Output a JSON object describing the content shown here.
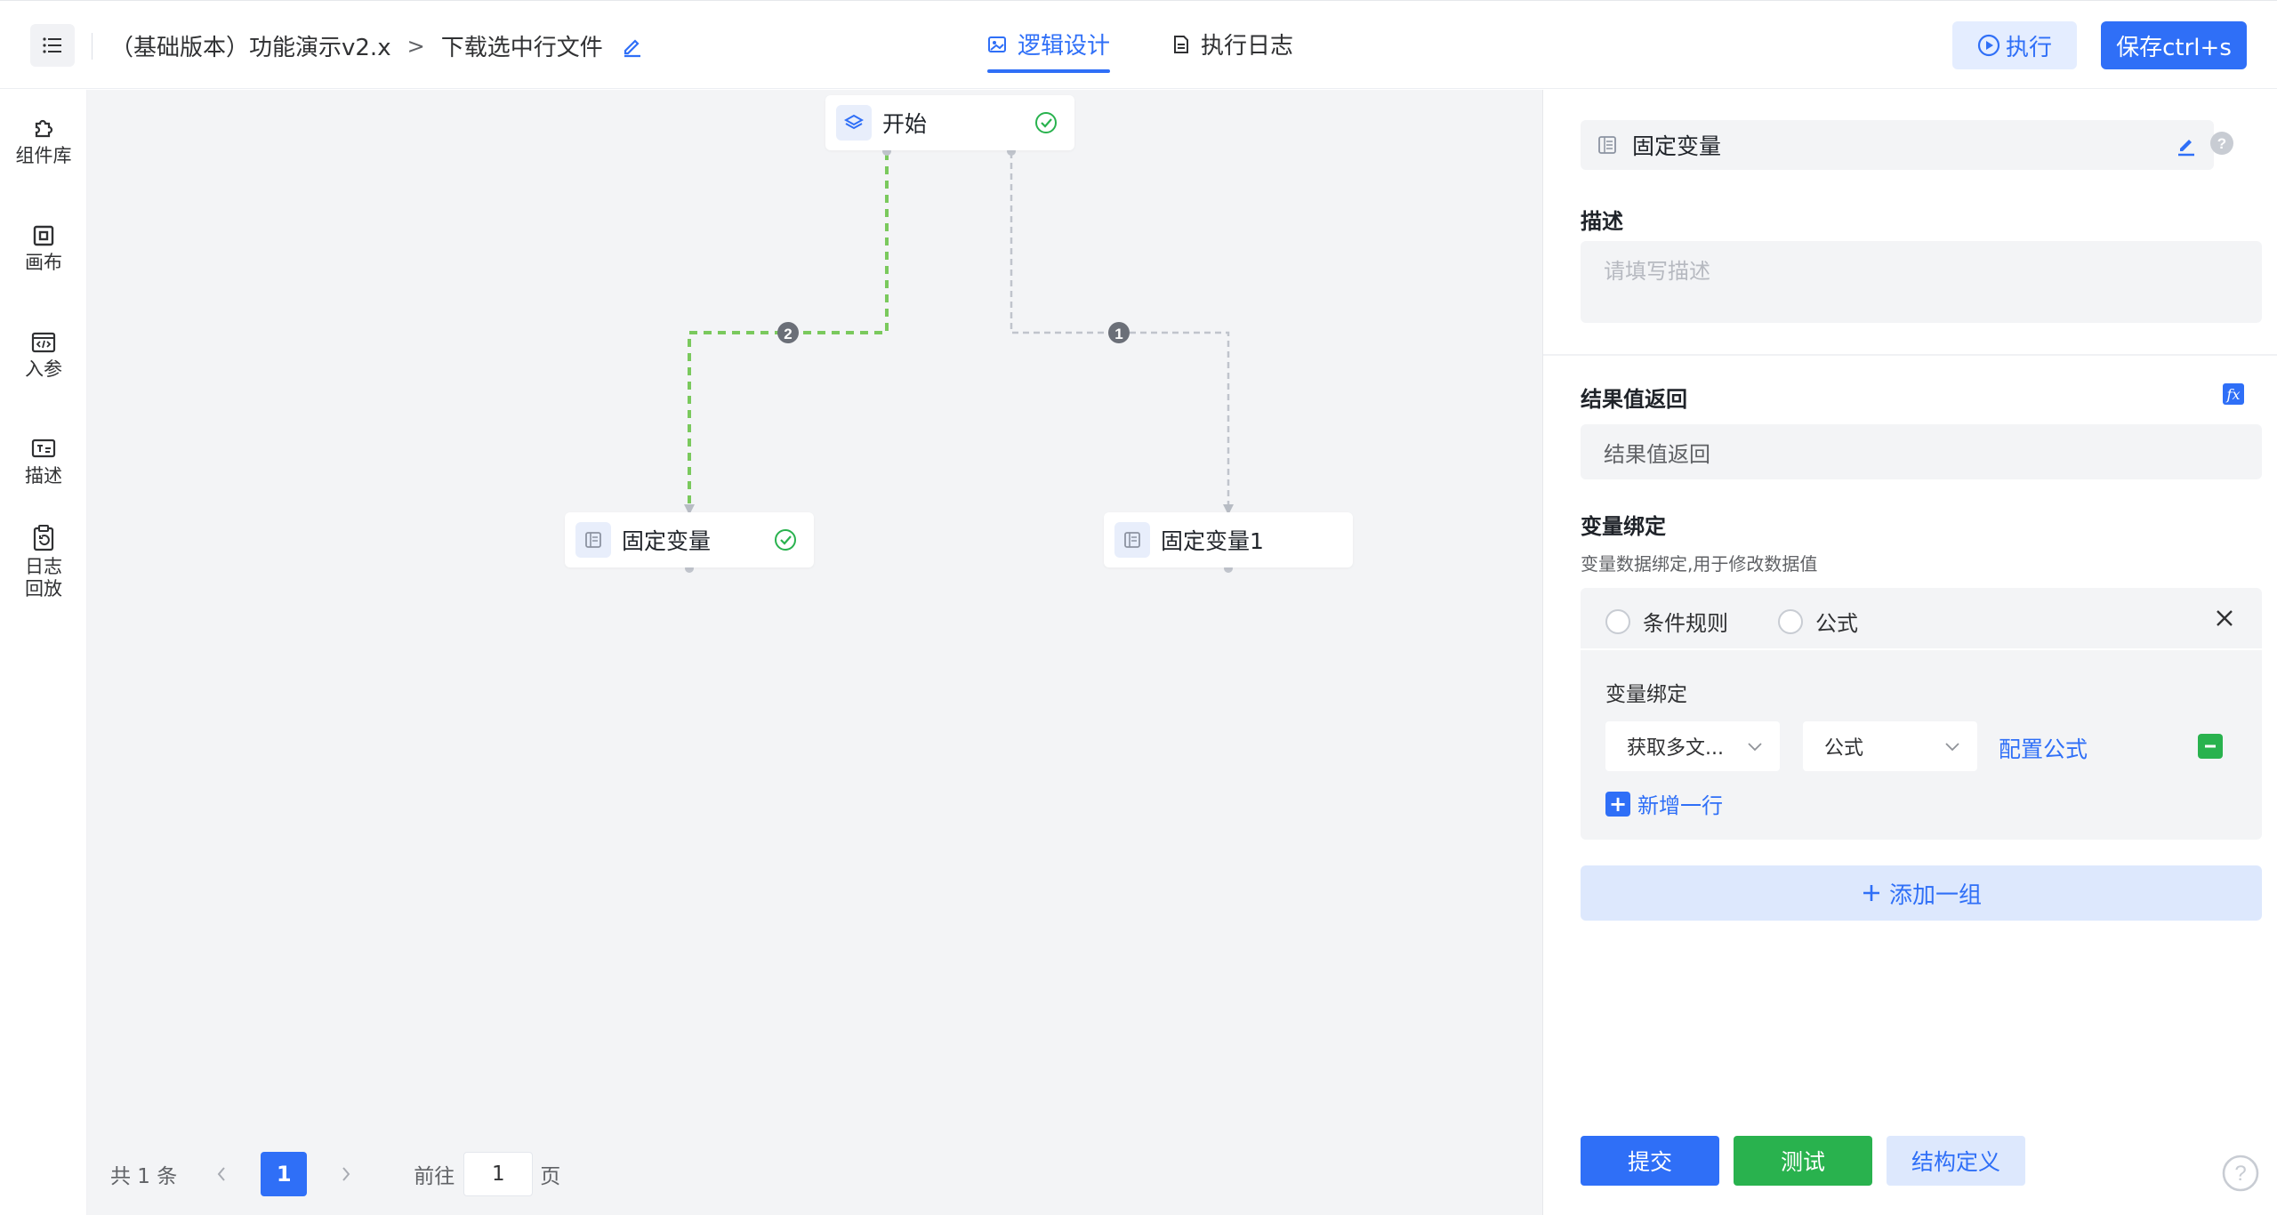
{
  "header": {
    "crumb_app": "（基础版本）功能演示v2.x",
    "crumb_separator": ">",
    "crumb_page": "下载选中行文件",
    "tabs": [
      {
        "label": "逻辑设计",
        "active": true
      },
      {
        "label": "执行日志",
        "active": false
      }
    ],
    "run_label": "执行",
    "save_label": "保存ctrl+s"
  },
  "sidebar": {
    "items": [
      {
        "label": "组件库",
        "icon": "puzzle-icon"
      },
      {
        "label": "画布",
        "icon": "canvas-icon"
      },
      {
        "label": "入参",
        "icon": "code-icon"
      },
      {
        "label": "描述",
        "icon": "text-icon"
      },
      {
        "label": "日志\n回放",
        "icon": "clipboard-replay-icon"
      }
    ]
  },
  "canvas": {
    "nodes": [
      {
        "label": "开始",
        "icon": "layers-icon",
        "status": "success"
      },
      {
        "label": "固定变量",
        "icon": "variable-icon",
        "status": "success"
      },
      {
        "label": "固定变量1",
        "icon": "variable-icon",
        "status": ""
      }
    ],
    "edges": [
      {
        "from": "开始",
        "to": "固定变量",
        "order": "2",
        "color": "#7ac95d"
      },
      {
        "from": "开始",
        "to": "固定变量1",
        "order": "1",
        "color": "#c0c4cc"
      }
    ],
    "pagination": {
      "total_text": "共 1 条",
      "current_page": "1",
      "goto_label": "前往",
      "goto_value": "1",
      "page_suffix": "页"
    }
  },
  "panel": {
    "node_title": "固定变量",
    "description_label": "描述",
    "description_placeholder": "请填写描述",
    "result_label": "结果值返回",
    "result_placeholder": "结果值返回",
    "binding_label": "变量绑定",
    "binding_hint": "变量数据绑定,用于修改数据值",
    "group": {
      "radio_options": [
        "条件规则",
        "公式"
      ],
      "inner_label": "变量绑定",
      "row": {
        "field_select": "获取多文...",
        "type_select": "公式",
        "config_link": "配置公式"
      },
      "add_row_label": "新增一行"
    },
    "add_group_label": "添加一组",
    "buttons": {
      "submit": "提交",
      "test": "测试",
      "structure": "结构定义"
    }
  },
  "colors": {
    "primary": "#2f6ff7",
    "success": "#29b24e",
    "canvas_bg": "#f3f4f6"
  }
}
